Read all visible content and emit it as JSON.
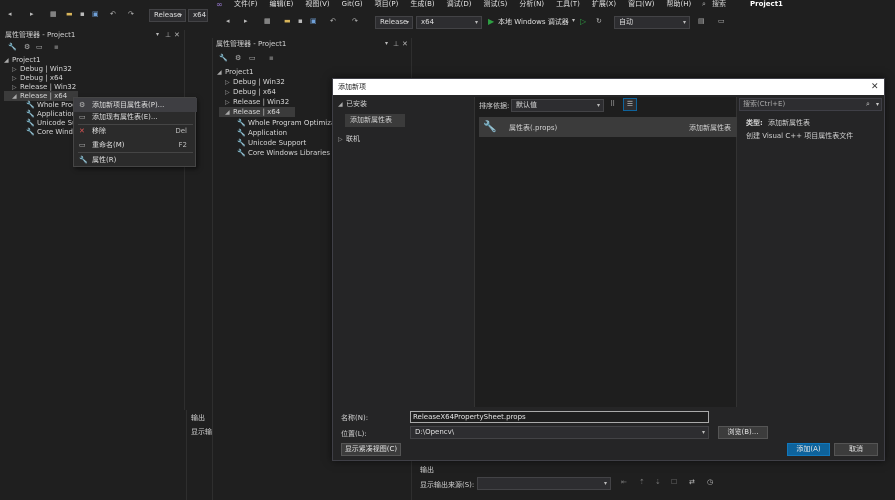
{
  "top_menu": {
    "items": [
      "文件(F)",
      "编辑(E)",
      "视图(V)",
      "Git(G)",
      "项目(P)",
      "生成(B)",
      "调试(D)",
      "测试(S)",
      "分析(N)",
      "工具(T)",
      "扩展(X)",
      "窗口(W)",
      "帮助(H)"
    ],
    "search": "搜索",
    "project": "Project1"
  },
  "toolbar": {
    "config": "Release",
    "platform": "x64",
    "run_label": "本地 Windows 调试器",
    "auto": "自动",
    "left_config": "Release",
    "left_platform": "x64"
  },
  "left_panel": {
    "title": "属性管理器 - Project1",
    "tree": {
      "root": "Project1",
      "configs": [
        "Debug | Win32",
        "Debug | x64",
        "Release | Win32",
        "Release | x64"
      ],
      "children": [
        "Whole Progra",
        "Application",
        "Unicode Supp",
        "Core Window"
      ]
    },
    "output_title": "输出",
    "output_source": "显示输"
  },
  "context_menu": {
    "items": [
      {
        "label": "添加新项目属性表(P)...",
        "shortcut": ""
      },
      {
        "label": "添加现有属性表(E)...",
        "shortcut": ""
      },
      {
        "label": "移除",
        "shortcut": "Del"
      },
      {
        "label": "重命名(M)",
        "shortcut": "F2"
      },
      {
        "label": "属性(R)",
        "shortcut": ""
      }
    ]
  },
  "mid_panel": {
    "title": "属性管理器 - Project1",
    "tree": {
      "root": "Project1",
      "configs": [
        "Debug | Win32",
        "Debug | x64",
        "Release | Win32",
        "Release | x64"
      ],
      "children": [
        "Whole Program Optimizat",
        "Application",
        "Unicode Support",
        "Core Windows Libraries"
      ]
    }
  },
  "dialog": {
    "title": "添加新项",
    "installed": "已安装",
    "installed_child": "添加新属性表",
    "online": "联机",
    "sort_label": "排序依据:",
    "sort_value": "默认值",
    "search_placeholder": "搜索(Ctrl+E)",
    "item_name": "属性表(.props)",
    "item_type": "添加新属性表",
    "type_label": "类型:",
    "type_value": "添加新属性表",
    "description": "创建 Visual C++ 项目属性表文件",
    "name_label": "名称(N):",
    "name_value": "ReleaseX64PropertySheet.props",
    "location_label": "位置(L):",
    "location_value": "D:\\Opencv\\",
    "browse": "浏览(B)...",
    "compact_view": "显示紧凑视图(C)",
    "add": "添加(A)",
    "cancel": "取消"
  },
  "output_panel": {
    "title": "输出",
    "source_label": "显示输出来源(S):"
  },
  "colors": {
    "accent": "#0e639c",
    "selection": "#3b3b3b",
    "dialog_bg": "#252526",
    "success_green": "#2ea043"
  }
}
